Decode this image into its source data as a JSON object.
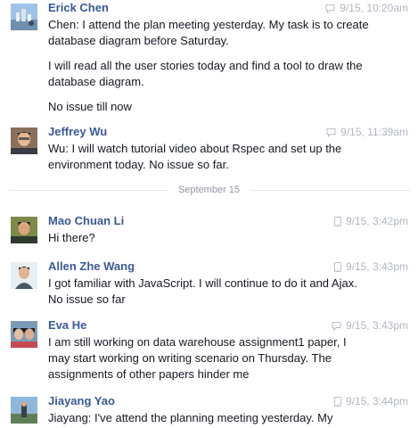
{
  "messages": [
    {
      "author": "Erick Chen",
      "timestamp": "9/15, 10:20am",
      "source_icon": "chat-bubble-icon",
      "paragraphs": [
        "Chen:  I attend the plan meeting yesterday. My task is to create database diagram before Saturday.",
        "I will read all the user stories today and find a tool to draw the database diagram.",
        "No issue till now"
      ]
    },
    {
      "author": "Jeffrey Wu",
      "timestamp": "9/15, 11:39am",
      "source_icon": "chat-bubble-icon",
      "paragraphs": [
        "Wu: I will watch tutorial video about Rspec and set up the environment today.  No issue so far."
      ]
    },
    {
      "author": "Mao Chuan Li",
      "timestamp": "9/15, 3:42pm",
      "source_icon": "mobile-phone-icon",
      "paragraphs": [
        "Hi there?"
      ]
    },
    {
      "author": "Allen Zhe Wang",
      "timestamp": "9/15, 3:43pm",
      "source_icon": "mobile-phone-icon",
      "paragraphs": [
        "I got familiar with JavaScript. I will continue to do it and Ajax. No issue so far"
      ]
    },
    {
      "author": "Eva He",
      "timestamp": "9/15, 3:43pm",
      "source_icon": "chat-bubble-icon",
      "paragraphs": [
        "I am still working on data warehouse assignment1 paper, I may start working on writing scenario on Thursday. The assignments of other papers hinder me"
      ]
    },
    {
      "author": "Jiayang Yao",
      "timestamp": "9/15, 3:44pm",
      "source_icon": "mobile-phone-icon",
      "paragraphs": [
        "Jiayang: I've attend the planning meeting yesterday. My"
      ]
    }
  ],
  "date_divider": "September 15",
  "colors": {
    "author_link": "#3b5998",
    "timestamp": "#b0b6c2",
    "divider_line": "#e5e7ec",
    "body_text": "#141823"
  }
}
